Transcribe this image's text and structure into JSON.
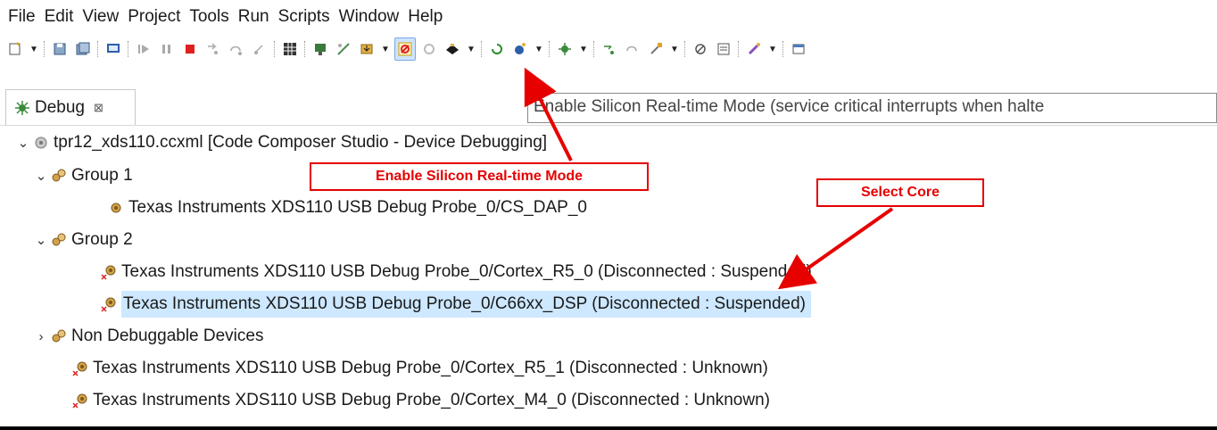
{
  "menu": [
    "File",
    "Edit",
    "View",
    "Project",
    "Tools",
    "Run",
    "Scripts",
    "Window",
    "Help"
  ],
  "toolbar_icons": [
    "new-icon",
    "dropdown-arrow",
    "save-icon",
    "save-all-icon",
    "terminal-icon",
    "resume-icon",
    "suspend-icon",
    "terminate-icon",
    "step-into-icon",
    "step-over-icon",
    "step-return-icon",
    "grid-icon",
    "connect-icon",
    "disconnect-icon",
    "load-program-icon",
    "dropdown-arrow",
    "realtime-mode-icon",
    "realtime-mode-disabled-icon",
    "target-icon",
    "dropdown-arrow",
    "restart-icon",
    "run-icon",
    "dropdown-arrow",
    "debug-icon",
    "dropdown-arrow",
    "step-icon",
    "step2-icon",
    "tools-icon",
    "dropdown-arrow",
    "breakpoint-icon",
    "memory-icon",
    "pin-icon",
    "dropdown-arrow",
    "open-perspective-icon"
  ],
  "debug_tab": {
    "label": "Debug",
    "close": "⊠"
  },
  "tooltip": "Enable Silicon Real-time Mode (service critical interrupts when halte",
  "tree": [
    {
      "indent": 0,
      "chevron": "⌄",
      "icon": "config-icon",
      "label": "tpr12_xds110.ccxml [Code Composer Studio - Device Debugging]"
    },
    {
      "indent": 1,
      "chevron": "⌄",
      "icon": "group-icon",
      "label": "Group 1"
    },
    {
      "indent": 2,
      "chevron": "",
      "icon": "cpu-icon",
      "label": "Texas Instruments XDS110 USB Debug Probe_0/CS_DAP_0"
    },
    {
      "indent": 1,
      "chevron": "⌄",
      "icon": "group-icon",
      "label": "Group 2"
    },
    {
      "indent": 2,
      "chevron": "",
      "icon": "cpu-disconnected-icon",
      "label": "Texas Instruments XDS110 USB Debug Probe_0/Cortex_R5_0 (Disconnected : Suspended)"
    },
    {
      "indent": 2,
      "chevron": "",
      "icon": "cpu-disconnected-icon",
      "label": "Texas Instruments XDS110 USB Debug Probe_0/C66xx_DSP (Disconnected : Suspended)",
      "selected": true
    },
    {
      "indent": 1,
      "chevron": "›",
      "icon": "group-icon",
      "label": "Non Debuggable Devices"
    },
    {
      "indent": 1,
      "chevron": "",
      "icon": "cpu-disconnected-icon",
      "label": "Texas Instruments XDS110 USB Debug Probe_0/Cortex_R5_1 (Disconnected : Unknown)"
    },
    {
      "indent": 1,
      "chevron": "",
      "icon": "cpu-disconnected-icon",
      "label": "Texas Instruments XDS110 USB Debug Probe_0/Cortex_M4_0 (Disconnected : Unknown)"
    }
  ],
  "callouts": {
    "realtime": "Enable Silicon Real-time Mode",
    "core": "Select Core"
  },
  "colors": {
    "accent": "#e60000",
    "selection": "#cde8ff"
  }
}
